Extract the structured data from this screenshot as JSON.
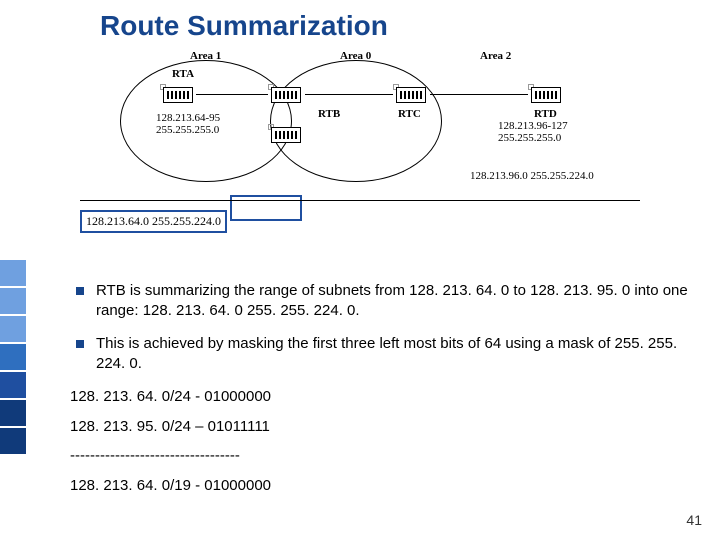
{
  "title": "Route Summarization",
  "diagram": {
    "areas": {
      "a1": "Area 1",
      "a0": "Area 0",
      "a2": "Area 2"
    },
    "routers": {
      "rta": "RTA",
      "rtb": "RTB",
      "rtc": "RTC",
      "rtd": "RTD"
    },
    "subnets": {
      "rta": "128.213.64-95\n255.255.255.0",
      "rtd": "128.213.96-127\n255.255.255.0"
    },
    "summary_right": "128.213.96.0 255.255.224.0",
    "summary_left": "128.213.64.0 255.255.224.0"
  },
  "bullets": [
    "RTB is summarizing the range of subnets from 128. 213. 64. 0 to 128. 213. 95. 0 into one range: 128. 213. 64. 0 255. 255. 224. 0.",
    "This is achieved by masking the first three left most bits of 64 using a mask of 255. 255. 224. 0."
  ],
  "calc": {
    "l1": "128. 213. 64. 0/24 -  01000000",
    "l2": "128. 213. 95. 0/24 – 01011111",
    "sep": "----------------------------------",
    "l3": "128. 213. 64. 0/19 -  01000000"
  },
  "pagenum": "41"
}
